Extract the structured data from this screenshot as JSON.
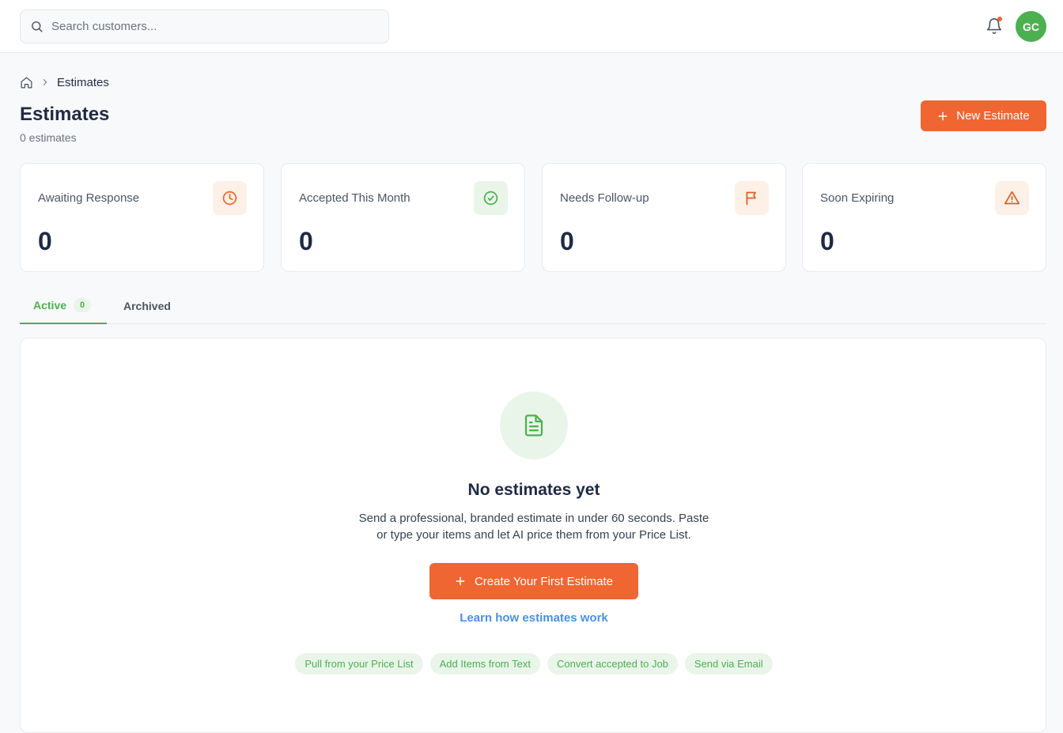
{
  "header": {
    "search_placeholder": "Search customers...",
    "avatar_initials": "GC",
    "notification_dot_color": "#ef6633"
  },
  "breadcrumb": {
    "home_icon": "home-icon",
    "current": "Estimates"
  },
  "page": {
    "title": "Estimates",
    "subtitle": "0 estimates",
    "new_button_label": "New Estimate"
  },
  "stats": [
    {
      "label": "Awaiting Response",
      "value": "0",
      "icon": "clock-icon",
      "icon_color": "#ef6633",
      "icon_bg": "#fdf0e6"
    },
    {
      "label": "Accepted This Month",
      "value": "0",
      "icon": "check-circle-icon",
      "icon_color": "#4caf50",
      "icon_bg": "#eaf5ea"
    },
    {
      "label": "Needs Follow-up",
      "value": "0",
      "icon": "flag-icon",
      "icon_color": "#d9622b",
      "icon_bg": "#fdf0e6"
    },
    {
      "label": "Soon Expiring",
      "value": "0",
      "icon": "warning-icon",
      "icon_color": "#d9622b",
      "icon_bg": "#fdf0e6"
    }
  ],
  "tabs": {
    "active_label": "Active",
    "active_count": "0",
    "archived_label": "Archived"
  },
  "empty_state": {
    "icon": "document-icon",
    "title": "No estimates yet",
    "desc_line1": "Send a professional, branded estimate in under 60 seconds. Paste",
    "desc_line2": "or type your items and let AI price them from your Price List.",
    "cta_label": "Create Your First Estimate",
    "link_label": "Learn how estimates work",
    "chips": [
      "Pull from your Price List",
      "Add Items from Text",
      "Convert accepted to Job",
      "Send via Email"
    ]
  },
  "colors": {
    "accent_orange": "#ef6633",
    "accent_green": "#4caf50",
    "link_blue": "#4a90e2"
  }
}
